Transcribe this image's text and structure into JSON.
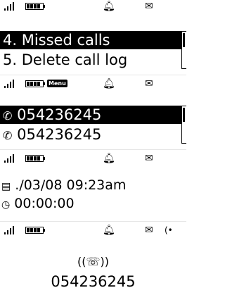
{
  "screens": [
    {
      "statusbar": {
        "signal": "signal-bars-icon",
        "battery": "battery-icon",
        "alert": "bell-icon",
        "message": "envelope-icon"
      },
      "menu": {
        "items": [
          {
            "label": "4. Missed calls",
            "selected": true
          },
          {
            "label": "5. Delete call log",
            "selected": false
          }
        ]
      }
    },
    {
      "statusbar": {
        "signal": "signal-bars-icon",
        "battery": "battery-icon",
        "menu_tag": "Menu",
        "alert": "bell-icon",
        "message": "envelope-icon"
      },
      "list": {
        "items": [
          {
            "icon": "missed-call-icon",
            "number": "054236245",
            "selected": true
          },
          {
            "icon": "missed-call-icon",
            "number": "054236245",
            "selected": false
          }
        ]
      }
    },
    {
      "statusbar": {
        "signal": "signal-bars-icon",
        "battery": "battery-icon",
        "alert": "bell-icon",
        "message": "envelope-icon"
      },
      "details": {
        "date_icon": "calendar-icon",
        "date": "./03/08 09:23am",
        "duration_icon": "timer-icon",
        "duration": "00:00:00"
      }
    },
    {
      "statusbar": {
        "signal": "signal-bars-icon",
        "battery": "battery-icon",
        "alert": "bell-icon",
        "message": "envelope-icon",
        "extra": "call-indicator-icon"
      },
      "calling": {
        "icon": "handset-icon",
        "number": "054236245"
      }
    }
  ]
}
